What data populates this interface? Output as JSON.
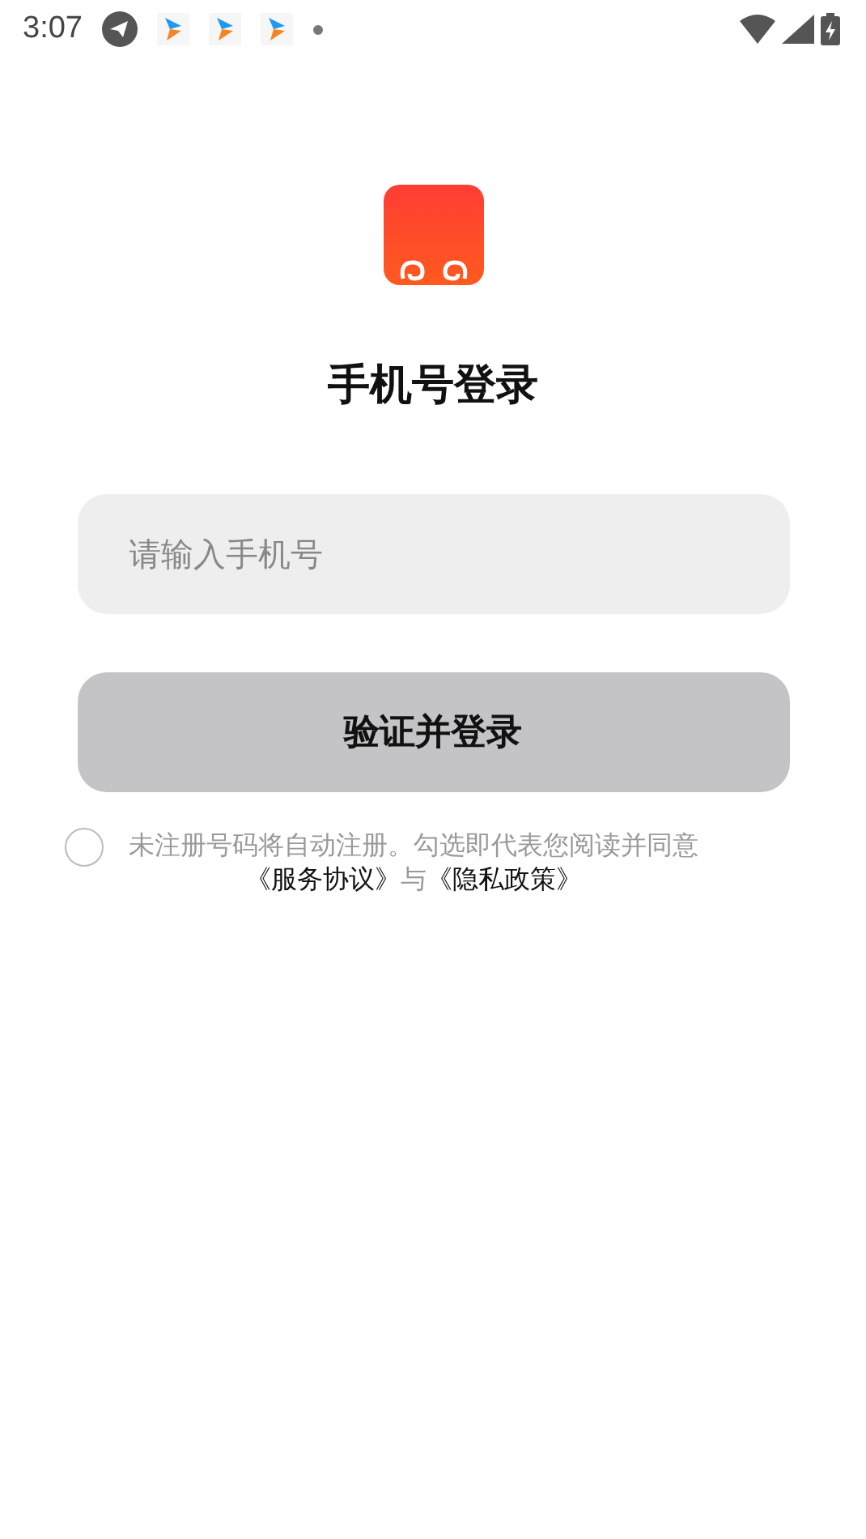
{
  "status_bar": {
    "time": "3:07"
  },
  "title": "手机号登录",
  "phone_field": {
    "placeholder": "请输入手机号"
  },
  "login_button": {
    "label": "验证并登录",
    "disabled": true
  },
  "agreement": {
    "checked": false,
    "notice": "未注册号码将自动注册。勾选即代表您阅读并同意",
    "links": [
      "《服务协议》",
      "《隐私政策》"
    ],
    "joiner": "与"
  }
}
